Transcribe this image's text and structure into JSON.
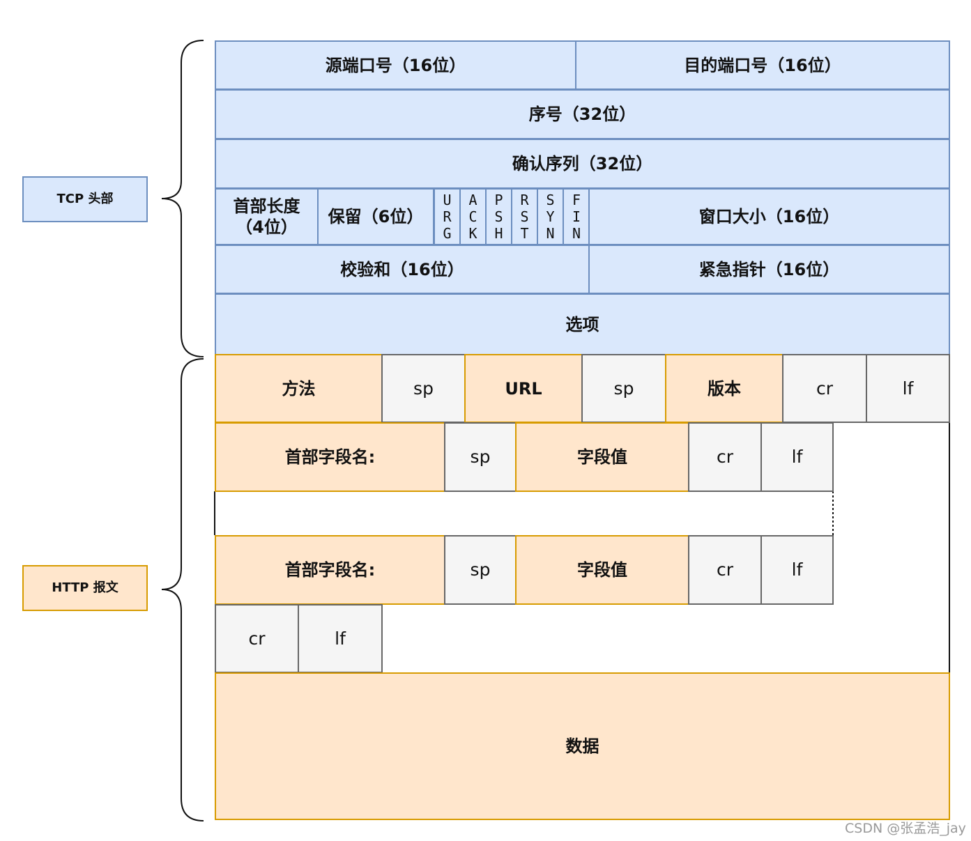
{
  "side_labels": {
    "tcp": "TCP 头部",
    "http": "HTTP 报文"
  },
  "tcp": {
    "src_port": "源端口号（16位）",
    "dst_port": "目的端口号（16位）",
    "seq": "序号（32位）",
    "ack": "确认序列（32位）",
    "header_len": "首部长度（4位）",
    "reserved": "保留（6位）",
    "flags": [
      "URG",
      "ACK",
      "PSH",
      "RST",
      "SYN",
      "FIN"
    ],
    "window": "窗口大小（16位）",
    "checksum": "校验和（16位）",
    "urgent": "紧急指针（16位）",
    "options": "选项"
  },
  "http": {
    "method": "方法",
    "sp": "sp",
    "url": "URL",
    "version": "版本",
    "cr": "cr",
    "lf": "lf",
    "header_name": "首部字段名:",
    "header_value": "字段值",
    "data": "数据"
  },
  "colors": {
    "tcp_fill": "#dae8fc",
    "tcp_stroke": "#6c8ebf",
    "http_fill": "#ffe6cc",
    "http_stroke": "#d79b00",
    "ctrl_fill": "#f5f5f5",
    "ctrl_stroke": "#666666"
  },
  "watermark": "CSDN @张孟浩_jay"
}
